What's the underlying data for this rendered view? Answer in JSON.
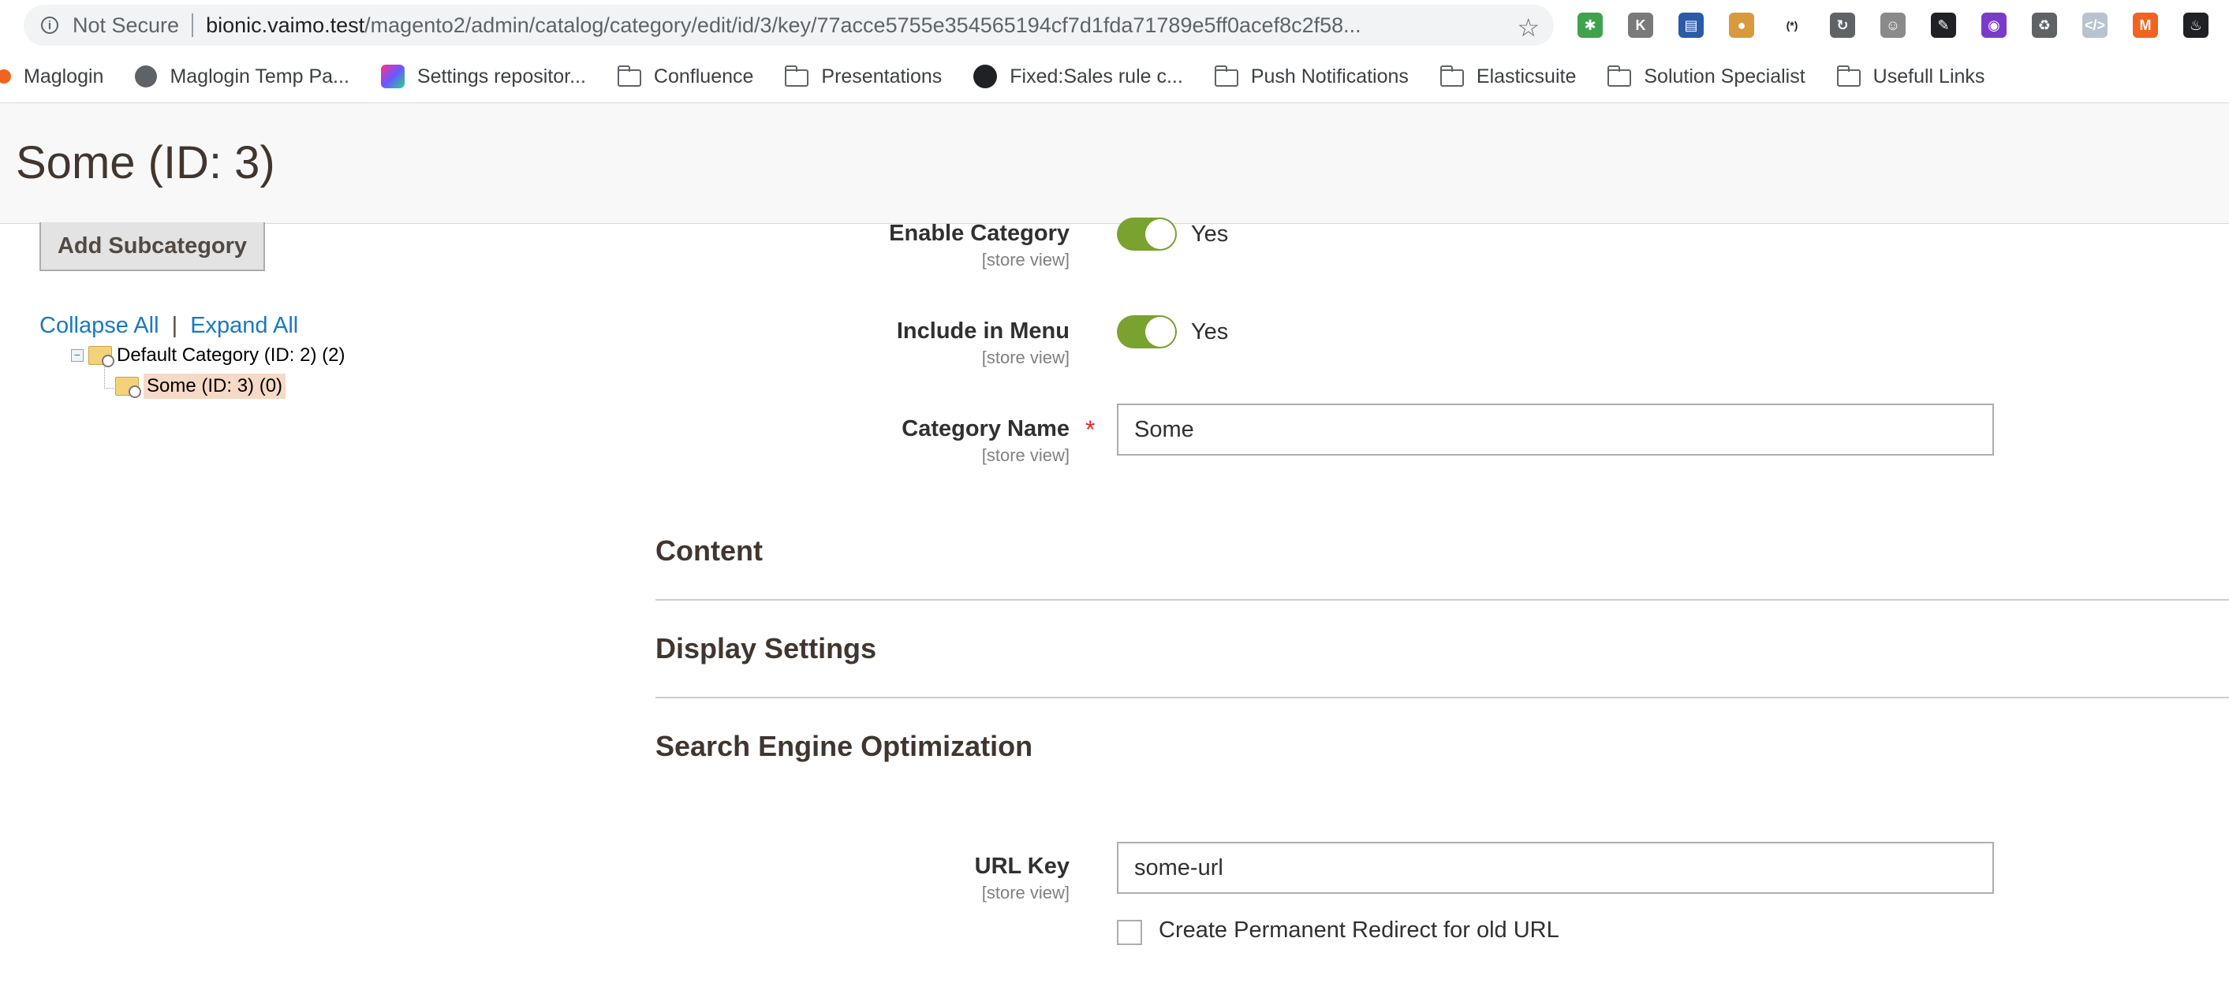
{
  "browser": {
    "security_label": "Not Secure",
    "url_host": "bionic.vaimo.test",
    "url_path": "/magento2/admin/catalog/category/edit/id/3/key/77acce5755e354565194cf7d1fda71789e5ff0acef8c2f58...",
    "extensions": [
      {
        "name": "bug-extension-icon",
        "color": "#3fa34d",
        "glyph": "✱"
      },
      {
        "name": "k-extension-icon",
        "color": "#7a7a7a",
        "glyph": "K"
      },
      {
        "name": "window-extension-icon",
        "color": "#2b5aa8",
        "glyph": "▤"
      },
      {
        "name": "cookie-extension-icon",
        "color": "#d99a3e",
        "glyph": "●"
      },
      {
        "name": "regex-extension-icon",
        "color": "#ffffff",
        "glyph": "(*)"
      },
      {
        "name": "refresh-extension-icon",
        "color": "#5f6368",
        "glyph": "↻"
      },
      {
        "name": "user-extension-icon",
        "color": "#8a8a8a",
        "glyph": "☺"
      },
      {
        "name": "pen-extension-icon",
        "color": "#202124",
        "glyph": "✎"
      },
      {
        "name": "color-picker-extension-icon",
        "color": "#7a3cc8",
        "glyph": "◉"
      },
      {
        "name": "recycle-extension-icon",
        "color": "#5f6368",
        "glyph": "♻"
      },
      {
        "name": "code-extension-icon",
        "color": "#b8c3cf",
        "glyph": "</>"
      },
      {
        "name": "magento-extension-icon",
        "color": "#f26322",
        "glyph": "M"
      },
      {
        "name": "fire-extension-icon",
        "color": "#202124",
        "glyph": "♨"
      }
    ],
    "bookmarks": [
      {
        "label": "Maglogin",
        "icon": "magento-icon"
      },
      {
        "label": "Maglogin Temp Pa...",
        "icon": "globe-icon"
      },
      {
        "label": "Settings repositor...",
        "icon": "jetbrains-icon"
      },
      {
        "label": "Confluence",
        "icon": "folder-icon"
      },
      {
        "label": "Presentations",
        "icon": "folder-icon"
      },
      {
        "label": "Fixed:Sales rule c...",
        "icon": "github-icon"
      },
      {
        "label": "Push Notifications",
        "icon": "folder-icon"
      },
      {
        "label": "Elasticsuite",
        "icon": "folder-icon"
      },
      {
        "label": "Solution Specialist",
        "icon": "folder-icon"
      },
      {
        "label": "Usefull Links",
        "icon": "folder-icon"
      }
    ]
  },
  "page": {
    "title": "Some (ID: 3)"
  },
  "tree": {
    "add_button": "Add Subcategory",
    "collapse_all": "Collapse All",
    "separator": "|",
    "expand_all": "Expand All",
    "nodes": [
      {
        "label": "Default Category (ID: 2) (2)"
      },
      {
        "label": "Some (ID: 3) (0)"
      }
    ]
  },
  "form": {
    "enable_category": {
      "label": "Enable Category",
      "scope": "[store view]",
      "value": "Yes"
    },
    "include_in_menu": {
      "label": "Include in Menu",
      "scope": "[store view]",
      "value": "Yes"
    },
    "category_name": {
      "label": "Category Name",
      "scope": "[store view]",
      "required_mark": "*",
      "value": "Some"
    },
    "sections": {
      "content": "Content",
      "display_settings": "Display Settings",
      "seo": "Search Engine Optimization"
    },
    "url_key": {
      "label": "URL Key",
      "scope": "[store view]",
      "value": "some-url"
    },
    "permanent_redirect": {
      "label": "Create Permanent Redirect for old URL",
      "checked": false
    }
  }
}
